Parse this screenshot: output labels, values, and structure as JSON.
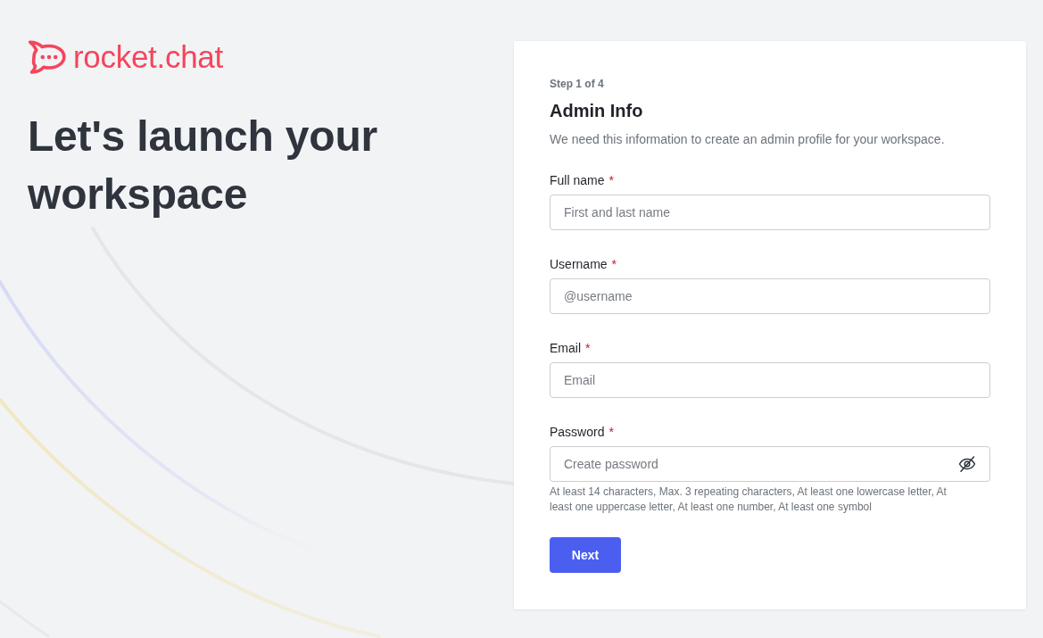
{
  "brand": {
    "name": "rocket.chat"
  },
  "headline": "Let's launch your workspace",
  "form": {
    "step": "Step 1 of 4",
    "title": "Admin Info",
    "description": "We need this information to create an admin profile for your workspace.",
    "fields": [
      {
        "kind": "text",
        "label": "Full name",
        "required_mark": "*",
        "placeholder": "First and last name"
      },
      {
        "kind": "text",
        "label": "Username",
        "required_mark": "*",
        "placeholder": "@username"
      },
      {
        "kind": "email",
        "label": "Email",
        "required_mark": "*",
        "placeholder": "Email"
      },
      {
        "kind": "password",
        "label": "Password",
        "required_mark": "*",
        "placeholder": "Create password",
        "hint": "At least 14 characters, Max. 3 repeating characters, At least one lowercase letter, At least one uppercase letter, At least one number, At least one symbol"
      }
    ],
    "submit": "Next"
  }
}
